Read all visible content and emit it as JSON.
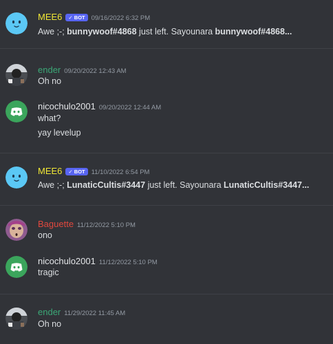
{
  "colors": {
    "background": "#313338",
    "mee6": "#f0e635",
    "ender": "#3ba776",
    "nicochulo": "#e3e5e8",
    "baguette": "#e0483e",
    "bot_badge": "#5865f2",
    "timestamp": "#949ba4"
  },
  "messages": [
    {
      "author": "MEE6",
      "badge": "✓ BOT",
      "timestamp": "09/16/2022 6:32 PM",
      "avatar_icon": "mee6-face-icon",
      "lines": [
        {
          "pre": "Awe ;-; ",
          "bold1": "bunnywoof#4868",
          "mid": " just left. Sayounara ",
          "bold2": "bunnywoof#4868..."
        }
      ]
    },
    {
      "author": "ender",
      "timestamp": "09/20/2022 12:43 AM",
      "avatar_icon": "user-photo-icon",
      "lines": [
        {
          "text": "Oh no"
        }
      ]
    },
    {
      "author": "nicochulo2001",
      "timestamp": "09/20/2022 12:44 AM",
      "avatar_icon": "discord-logo-icon",
      "lines": [
        {
          "text": "what?"
        },
        {
          "text": "yay levelup"
        }
      ]
    },
    {
      "author": "MEE6",
      "badge": "✓ BOT",
      "timestamp": "11/10/2022 6:54 PM",
      "avatar_icon": "mee6-face-icon",
      "lines": [
        {
          "pre": "Awe ;-; ",
          "bold1": "LunaticCultis#3447",
          "mid": " just left. Sayounara ",
          "bold2": "LunaticCultis#3447..."
        }
      ]
    },
    {
      "author": "Baguette",
      "timestamp": "11/12/2022 5:10 PM",
      "avatar_icon": "user-photo-icon",
      "lines": [
        {
          "text": "ono"
        }
      ]
    },
    {
      "author": "nicochulo2001",
      "timestamp": "11/12/2022 5:10 PM",
      "avatar_icon": "discord-logo-icon",
      "lines": [
        {
          "text": "tragic"
        }
      ]
    },
    {
      "author": "ender",
      "timestamp": "11/29/2022 11:45 AM",
      "avatar_icon": "user-photo-icon",
      "lines": [
        {
          "text": "Oh no"
        }
      ]
    }
  ]
}
